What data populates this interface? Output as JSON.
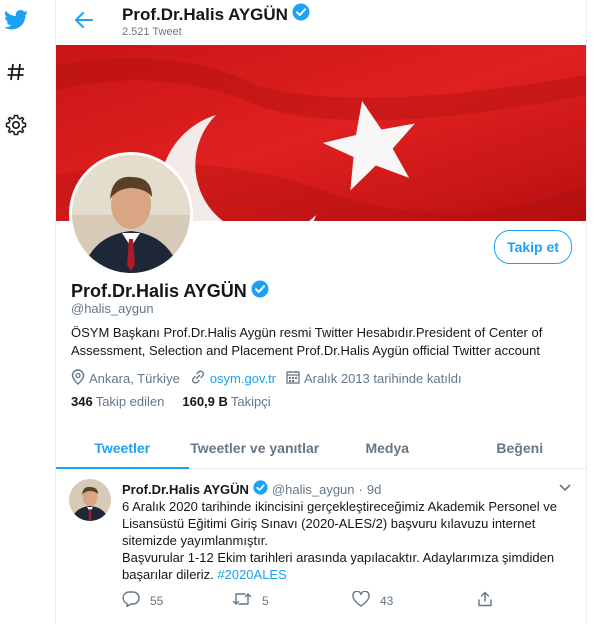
{
  "nav": {
    "icons": [
      "twitter-bird-icon",
      "hashtag-icon",
      "gear-icon"
    ]
  },
  "header": {
    "name": "Prof.Dr.Halis AYGÜN",
    "tweet_count": "2.521 Tweet"
  },
  "profile": {
    "name": "Prof.Dr.Halis AYGÜN",
    "handle": "@halis_aygun",
    "bio": "ÖSYM Başkanı Prof.Dr.Halis Aygün resmi Twitter Hesabıdır.President of Center of Assessment, Selection and Placement Prof.Dr.Halis Aygün official Twitter account",
    "location": "Ankara, Türkiye",
    "website": "osym.gov.tr",
    "joined": "Aralık 2013 tarihinde katıldı",
    "following_count": "346",
    "following_label": "Takip edilen",
    "followers_count": "160,9 B",
    "followers_label": "Takipçi",
    "follow_button": "Takip et"
  },
  "tabs": [
    {
      "label": "Tweetler",
      "active": true
    },
    {
      "label": "Tweetler ve yanıtlar",
      "active": false
    },
    {
      "label": "Medya",
      "active": false
    },
    {
      "label": "Beğeni",
      "active": false
    }
  ],
  "tweet": {
    "name": "Prof.Dr.Halis AYGÜN",
    "handle": "@halis_aygun",
    "separator": "·",
    "time": "9d",
    "text_line1": "6 Aralık 2020 tarihinde ikincisini gerçekleştireceğimiz Akademik Personel ve Lisansüstü Eğitimi Giriş Sınavı (2020-ALES/2) başvuru kılavuzu internet sitemizde yayımlanmıştır.",
    "text_line2": "Başvurular 1-12 Ekim tarihleri arasında yapılacaktır. Adaylarımıza şimdiden başarılar dileriz. ",
    "hashtag": "#2020ALES",
    "replies": "55",
    "retweets": "5",
    "likes": "43"
  },
  "colors": {
    "accent": "#1da1f2",
    "secondary_text": "#657786",
    "flag_red": "#d11a1a",
    "border": "#e6ecf0"
  }
}
